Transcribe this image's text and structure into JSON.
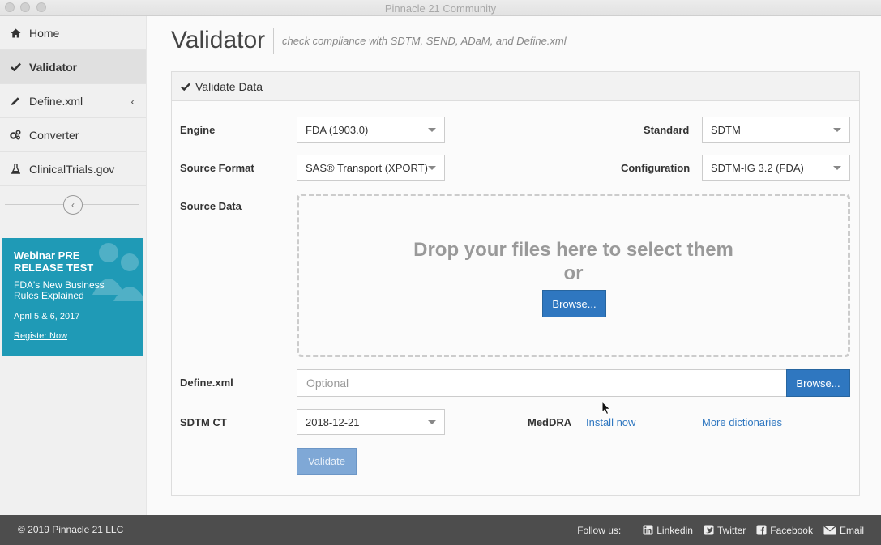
{
  "window": {
    "title": "Pinnacle 21 Community"
  },
  "sidebar": {
    "items": [
      {
        "label": "Home",
        "icon": "home-icon"
      },
      {
        "label": "Validator",
        "icon": "check-icon",
        "active": true
      },
      {
        "label": "Define.xml",
        "icon": "pencil-icon"
      },
      {
        "label": "Converter",
        "icon": "gears-icon"
      },
      {
        "label": "ClinicalTrials.gov",
        "icon": "flask-icon"
      }
    ],
    "webinar": {
      "title": "Webinar PRE RELEASE TEST",
      "subtitle": "FDA's New Business Rules Explained",
      "date": "April 5 & 6, 2017",
      "link": "Register Now"
    }
  },
  "header": {
    "title": "Validator",
    "subtitle": "check compliance with SDTM, SEND, ADaM, and Define.xml"
  },
  "panel": {
    "title": "Validate Data",
    "engine": {
      "label": "Engine",
      "value": "FDA (1903.0)"
    },
    "standard": {
      "label": "Standard",
      "value": "SDTM"
    },
    "source_format": {
      "label": "Source Format",
      "value": "SAS® Transport (XPORT)"
    },
    "configuration": {
      "label": "Configuration",
      "value": "SDTM-IG 3.2 (FDA)"
    },
    "source_data": {
      "label": "Source Data",
      "drop_text": "Drop your files here to select them",
      "or_text": "or",
      "browse": "Browse..."
    },
    "define": {
      "label": "Define.xml",
      "placeholder": "Optional",
      "browse": "Browse..."
    },
    "sdtm_ct": {
      "label": "SDTM CT",
      "value": "2018-12-21"
    },
    "meddra": {
      "label": "MedDRA",
      "install": "Install now"
    },
    "more_dictionaries": "More dictionaries",
    "validate": "Validate"
  },
  "footer": {
    "copyright": "© 2019 Pinnacle 21 LLC",
    "follow_label": "Follow us:",
    "links": [
      "Linkedin",
      "Twitter",
      "Facebook",
      "Email"
    ]
  },
  "colors": {
    "accent": "#2f77c0",
    "webinar_bg": "#1f9ab6",
    "footer_bg": "#4d4d4d"
  }
}
